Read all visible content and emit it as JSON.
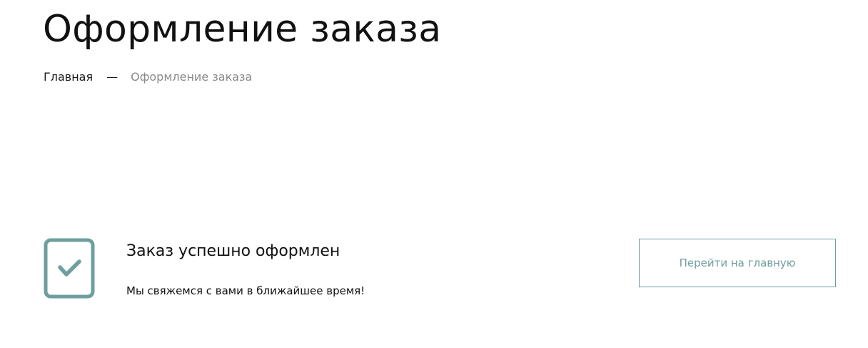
{
  "page": {
    "title": "Оформление заказа"
  },
  "breadcrumb": {
    "home": "Главная",
    "separator": "—",
    "current": "Оформление заказа"
  },
  "success": {
    "icon": "checkbox-check-icon",
    "title": "Заказ успешно оформлен",
    "message": "Мы свяжемся с вами в ближайшее время!"
  },
  "actions": {
    "home_button_label": "Перейти на главную"
  },
  "colors": {
    "accent": "#6f9ea0",
    "text": "#111111",
    "muted": "#8a8a8a"
  }
}
